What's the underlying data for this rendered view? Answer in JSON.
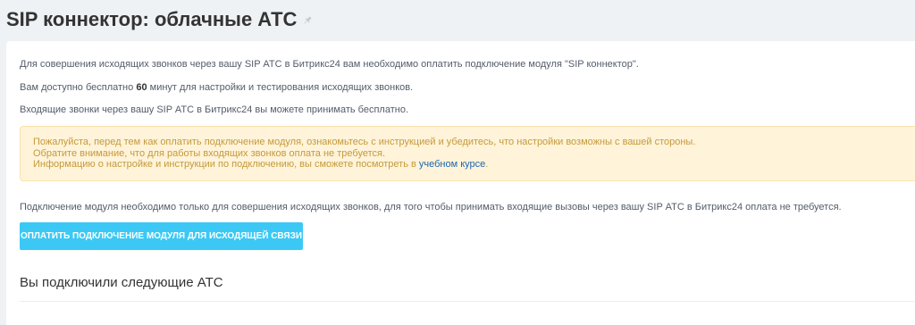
{
  "header": {
    "title": "SIP коннектор: облачные АТС",
    "pin_icon": "pin-icon"
  },
  "content": {
    "intro": "Для совершения исходящих звонков через вашу SIP АТС в Битрикс24 вам необходимо оплатить подключение модуля \"SIP коннектор\".",
    "free_minutes_prefix": "Вам доступно бесплатно",
    "free_minutes_value": "60",
    "free_minutes_suffix": "минут для настройки и тестирования исходящих звонков.",
    "incoming_free": "Входящие звонки через вашу SIP АТС в Битрикс24 вы можете принимать бесплатно.",
    "alert": {
      "line1": "Пожалуйста, перед тем как оплатить подключение модуля, ознакомьтесь с инструкцией и убедитесь, что настройки возможны с вашей стороны.",
      "line2": "Обратите внимание, что для работы входящих звонков оплата не требуется.",
      "line3_prefix": "Информацию о настройке и инструкции по подключению, вы сможете посмотреть в",
      "line3_link": "учебном курсе",
      "line3_suffix": "."
    },
    "note": "Подключение модуля необходимо только для совершения исходящих звонков, для того чтобы принимать входящие вызовы через вашу SIP АТС в Битрикс24 оплата не требуется.",
    "pay_button_label": "Оплатить подключение модуля для исходящей связи",
    "connected_title": "Вы подключили следующие АТС"
  },
  "colors": {
    "background": "#eef2f4",
    "button": "#3bc8f5",
    "alert_bg": "#fff3d9",
    "alert_text": "#c59a3a",
    "link": "#2067b0"
  }
}
